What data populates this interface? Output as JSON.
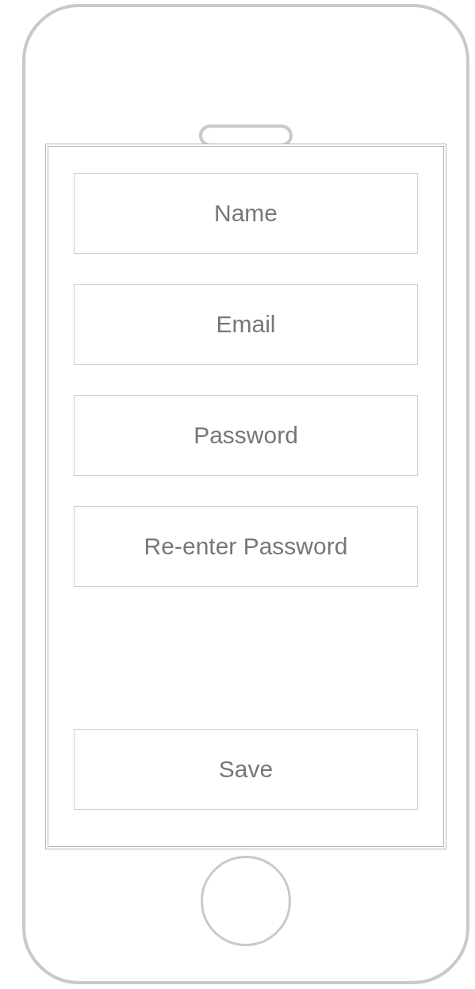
{
  "fields": [
    {
      "placeholder": "Name"
    },
    {
      "placeholder": "Email"
    },
    {
      "placeholder": "Password"
    },
    {
      "placeholder": "Re-enter Password"
    }
  ],
  "buttons": [
    {
      "label": "Save"
    }
  ]
}
